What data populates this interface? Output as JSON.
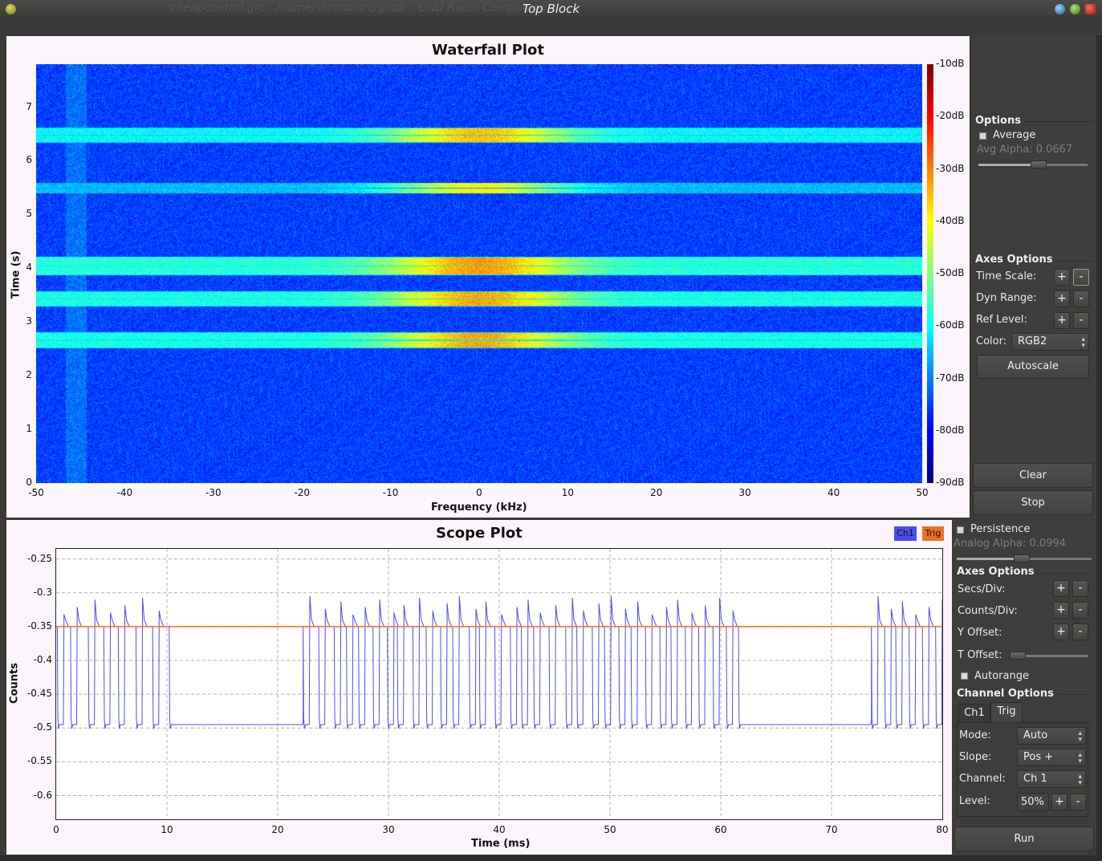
{
  "window": {
    "title": "Top Block",
    "ghost_title": "cheapcontrol.grc - /home/skrono/src/grsdr - GNU Radio Companion"
  },
  "waterfall": {
    "title": "Waterfall Plot",
    "xlabel": "Frequency (kHz)",
    "ylabel": "Time (s)",
    "x_ticks": [
      "-50",
      "-40",
      "-30",
      "-20",
      "-10",
      "0",
      "10",
      "20",
      "30",
      "40",
      "50"
    ],
    "y_ticks": [
      "0",
      "1",
      "2",
      "3",
      "4",
      "5",
      "6",
      "7"
    ],
    "colorbar_ticks": [
      "-10dB",
      "-20dB",
      "-30dB",
      "-40dB",
      "-50dB",
      "-60dB",
      "-70dB",
      "-80dB",
      "-90dB"
    ]
  },
  "wf_controls": {
    "options_label": "Options",
    "average_label": "Average",
    "avg_alpha_label": "Avg Alpha:",
    "avg_alpha_value": "0.0667",
    "avg_alpha_fraction": 0.55,
    "axes_options_label": "Axes Options",
    "time_scale_label": "Time Scale:",
    "dyn_range_label": "Dyn Range:",
    "ref_level_label": "Ref Level:",
    "color_label": "Color:",
    "color_value": "RGB2",
    "plus": "+",
    "minus": "-",
    "autoscale_label": "Autoscale",
    "clear_label": "Clear",
    "stop_label": "Stop"
  },
  "scope": {
    "title": "Scope Plot",
    "xlabel": "Time (ms)",
    "ylabel": "Counts",
    "legend": [
      {
        "name": "Ch1",
        "color": "#4c4cf0"
      },
      {
        "name": "Trig",
        "color": "#f07020"
      }
    ],
    "x_ticks": [
      "0",
      "10",
      "20",
      "30",
      "40",
      "50",
      "60",
      "70",
      "80"
    ],
    "y_ticks": [
      "-0.25",
      "-0.3",
      "-0.35",
      "-0.4",
      "-0.45",
      "-0.5",
      "-0.55",
      "-0.6"
    ]
  },
  "scope_controls": {
    "persistence_label": "Persistence",
    "analog_alpha_label": "Analog Alpha:",
    "analog_alpha_value": "0.0994",
    "analog_alpha_fraction": 0.48,
    "axes_options_label": "Axes Options",
    "secs_div_label": "Secs/Div:",
    "counts_div_label": "Counts/Div:",
    "y_offset_label": "Y Offset:",
    "t_offset_label": "T Offset:",
    "autorange_label": "Autorange",
    "channel_options_label": "Channel Options",
    "tab_ch1": "Ch1",
    "tab_trig": "Trig",
    "mode_label": "Mode:",
    "mode_value": "Auto",
    "slope_label": "Slope:",
    "slope_value": "Pos +",
    "channel_label": "Channel:",
    "channel_value": "Ch 1",
    "level_label": "Level:",
    "level_value": "50%",
    "plus": "+",
    "minus": "-",
    "run_label": "Run"
  },
  "colors": {
    "ch1": "#4c4cf0",
    "trig": "#f07020",
    "panel_bg": "#fcf6fc",
    "side_bg": "#3d3d3b"
  },
  "chart_data": [
    {
      "type": "heatmap",
      "title": "Waterfall Plot",
      "xlabel": "Frequency (kHz)",
      "ylabel": "Time (s)",
      "xlim": [
        -50,
        50
      ],
      "ylim": [
        0,
        7.8
      ],
      "colorbar_range_db": [
        -90,
        -10
      ],
      "noise_floor_db": -75,
      "bursts": [
        {
          "t_start": 2.52,
          "t_end": 2.82,
          "peak_db": -33
        },
        {
          "t_start": 3.3,
          "t_end": 3.58,
          "peak_db": -33
        },
        {
          "t_start": 3.88,
          "t_end": 4.22,
          "peak_db": -32
        },
        {
          "t_start": 5.4,
          "t_end": 5.6,
          "peak_db": -40
        },
        {
          "t_start": 6.35,
          "t_end": 6.62,
          "peak_db": -35
        }
      ],
      "burst_center_khz": 0,
      "grid": false
    },
    {
      "type": "line",
      "title": "Scope Plot",
      "xlabel": "Time (ms)",
      "ylabel": "Counts",
      "xlim": [
        0,
        80
      ],
      "ylim": [
        -0.635,
        -0.235
      ],
      "grid": true,
      "legend": "top-right",
      "series": [
        {
          "name": "Ch1",
          "high": -0.35,
          "low": -0.495,
          "pulse_starts_ms": [
            0.1,
            1.3,
            2.9,
            4.3,
            5.6,
            7.2,
            8.7,
            10.2,
            22.3,
            23.7,
            25.1,
            26.2,
            27.3,
            28.6,
            29.9,
            30.8,
            32.2,
            33.4,
            34.7,
            35.8,
            37.3,
            38.2,
            39.6,
            41.0,
            42.0,
            43.1,
            44.5,
            46.0,
            47.0,
            48.4,
            49.5,
            50.8,
            51.9,
            53.2,
            54.5,
            55.5,
            56.8,
            58.0,
            59.3,
            60.5,
            61.6,
            73.6,
            74.8,
            75.8,
            77.0,
            78.2,
            79.4
          ],
          "pulse_width_ms": 0.55
        },
        {
          "name": "Trig",
          "values_constant": -0.35
        }
      ]
    }
  ]
}
